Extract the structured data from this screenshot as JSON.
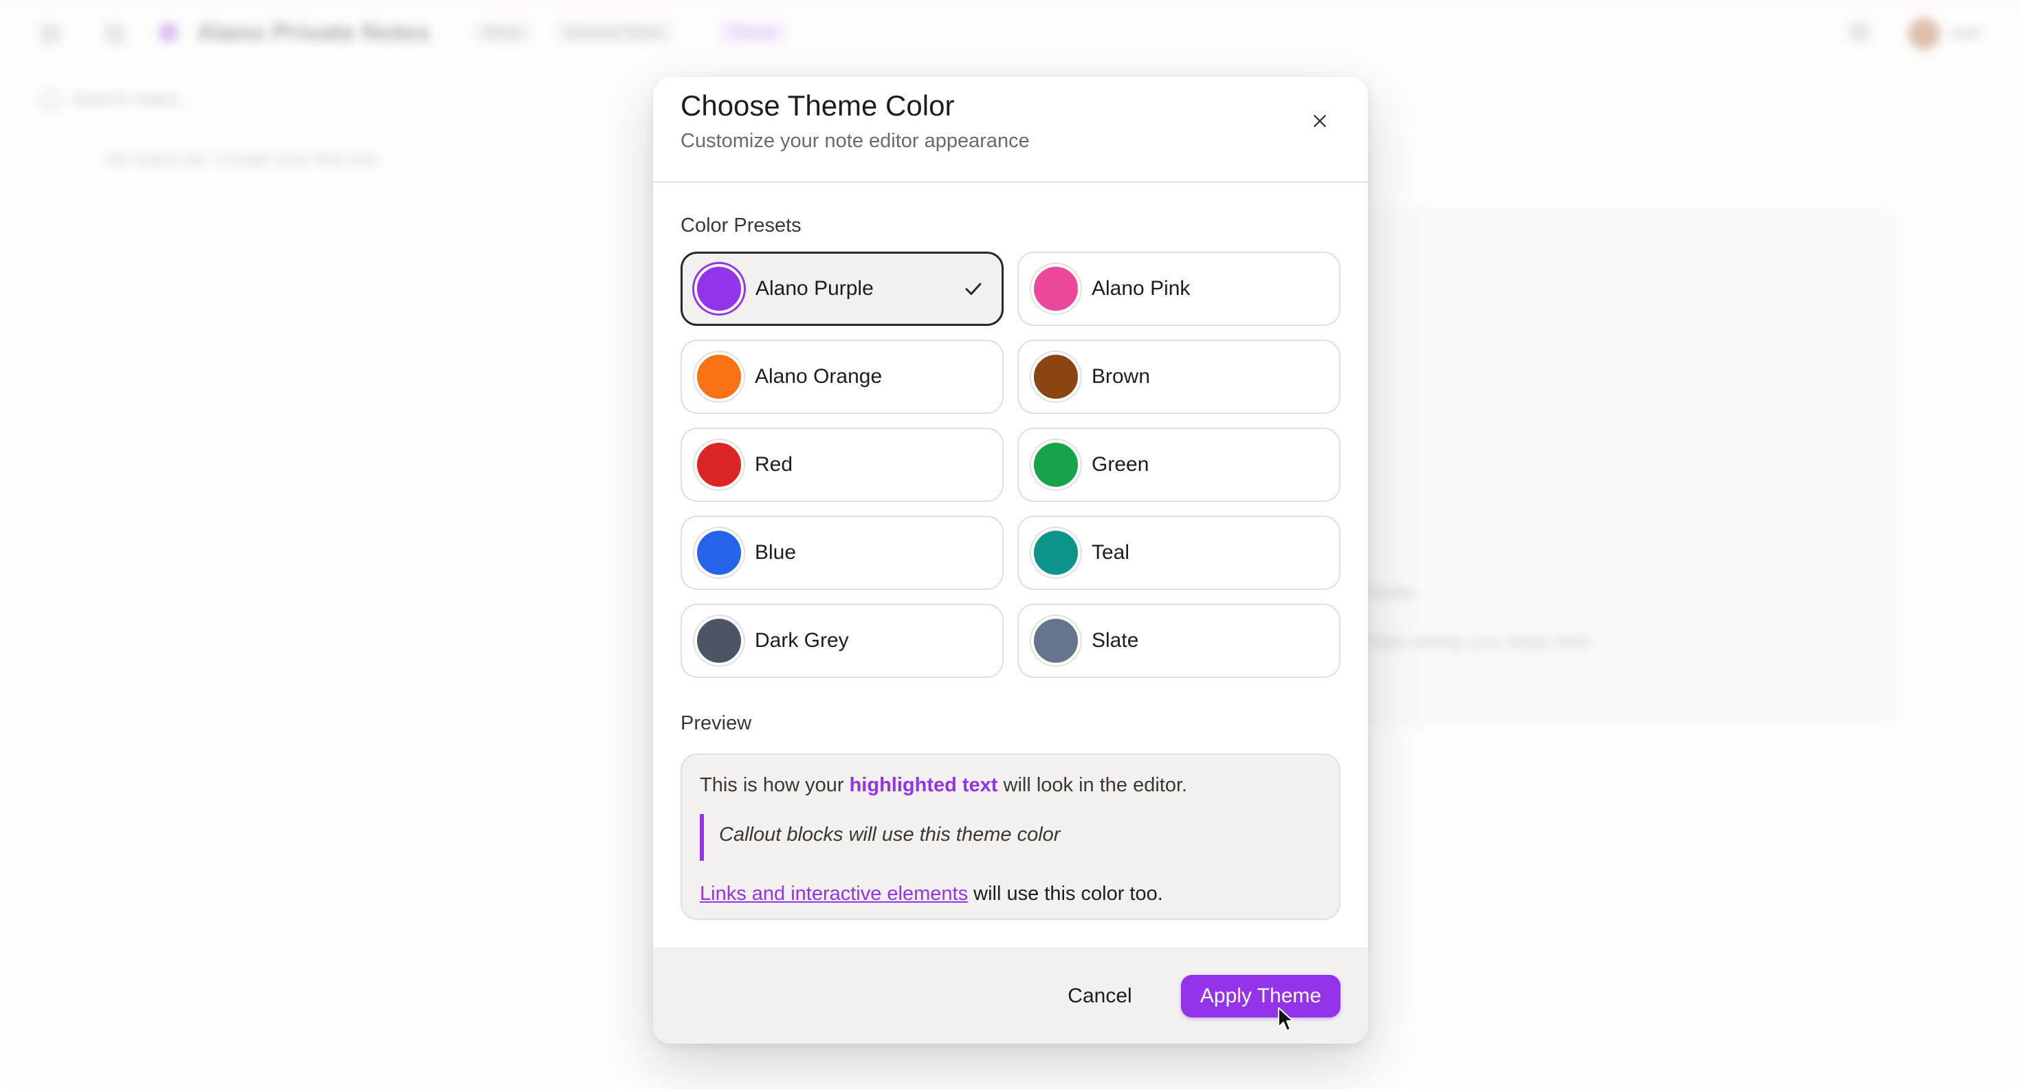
{
  "background": {
    "app_title": "Alano Private Notes",
    "chips": [
      "Ideas",
      "General Notes",
      "Theme"
    ],
    "user": "user",
    "search_placeholder": "Search notes...",
    "empty_text": "No notes yet. Create your first one",
    "right_texts": [
      "Notes",
      "Start writing your ideas here"
    ]
  },
  "modal": {
    "title": "Choose Theme Color",
    "subtitle": "Customize your note editor appearance",
    "presets_label": "Color Presets",
    "presets": [
      {
        "name": "Alano Purple",
        "color": "#9333ea",
        "selected": true
      },
      {
        "name": "Alano Pink",
        "color": "#ec4899",
        "selected": false
      },
      {
        "name": "Alano Orange",
        "color": "#f97316",
        "selected": false
      },
      {
        "name": "Brown",
        "color": "#8b4513",
        "selected": false
      },
      {
        "name": "Red",
        "color": "#dc2626",
        "selected": false
      },
      {
        "name": "Green",
        "color": "#16a34a",
        "selected": false
      },
      {
        "name": "Blue",
        "color": "#2563eb",
        "selected": false
      },
      {
        "name": "Teal",
        "color": "#0d9488",
        "selected": false
      },
      {
        "name": "Dark Grey",
        "color": "#4b5563",
        "selected": false
      },
      {
        "name": "Slate",
        "color": "#64748b",
        "selected": false
      }
    ],
    "preview_label": "Preview",
    "preview": {
      "line1_before": "This is how your ",
      "line1_highlight": "highlighted text",
      "line1_after": " will look in the editor.",
      "callout": "Callout blocks will use this theme color",
      "link_text": "Links and interactive elements",
      "link_after": " will use this color too."
    },
    "cancel_label": "Cancel",
    "apply_label": "Apply Theme"
  },
  "theme": {
    "accent": "#9333ea"
  },
  "icons": {
    "close": "close-icon",
    "check": "check-icon",
    "cursor": "mouse-pointer-icon"
  }
}
